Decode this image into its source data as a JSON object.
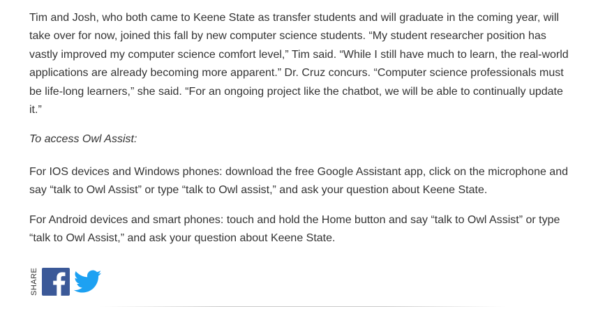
{
  "article": {
    "paragraphs": [
      "Tim and Josh, who both came to Keene State as transfer students and will graduate in the coming year, will take over for now, joined this fall by new computer science students. “My student researcher position has vastly improved my computer science comfort level,” Tim said. “While I still have much to learn, the real-world applications are already becoming more apparent.” Dr. Cruz concurs. “Computer science professionals must be life-long learners,” she said. “For an ongoing project like the chatbot, we will be able to continually update it.”",
      "To access Owl Assist:",
      "For IOS devices and Windows phones: download the free Google Assistant app, click on the microphone and say “talk to Owl Assist” or type “talk to Owl assist,” and ask your question about Keene State.",
      "For Android devices and smart phones: touch and hold the Home button and say “talk to Owl Assist” or type “talk to Owl Assist,” and ask your question about Keene State."
    ]
  },
  "share": {
    "label": "SHARE",
    "icons": [
      "facebook-icon",
      "twitter-icon"
    ],
    "colors": {
      "facebook": "#3b5998",
      "twitter": "#1da1f2"
    }
  }
}
